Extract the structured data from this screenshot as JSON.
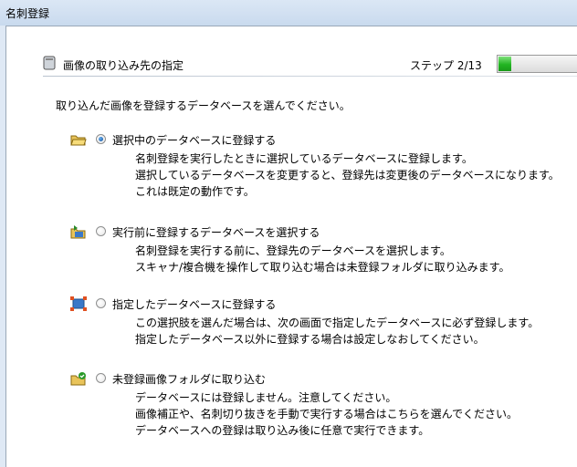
{
  "window": {
    "title": "名刺登録"
  },
  "header": {
    "title": "画像の取り込み先の指定",
    "step_label": "ステップ 2/13",
    "progress_fraction": 0.154
  },
  "intro": "取り込んだ画像を登録するデータベースを選んでください。",
  "options": [
    {
      "label": "選択中のデータベースに登録する",
      "selected": true,
      "desc": [
        "名刺登録を実行したときに選択しているデータベースに登録します。",
        "選択しているデータベースを変更すると、登録先は変更後のデータベースになります。",
        "これは既定の動作です。"
      ]
    },
    {
      "label": "実行前に登録するデータベースを選択する",
      "selected": false,
      "desc": [
        "名刺登録を実行する前に、登録先のデータベースを選択します。",
        "スキャナ/複合機を操作して取り込む場合は未登録フォルダに取り込みます。"
      ]
    },
    {
      "label": "指定したデータベースに登録する",
      "selected": false,
      "desc": [
        "この選択肢を選んだ場合は、次の画面で指定したデータベースに必ず登録します。",
        "指定したデータベース以外に登録する場合は設定しなおしてください。"
      ]
    },
    {
      "label": "未登録画像フォルダに取り込む",
      "selected": false,
      "desc": [
        "データベースには登録しません。注意してください。",
        "画像補正や、名刺切り抜きを手動で実行する場合はこちらを選んでください。",
        "データベースへの登録は取り込み後に任意で実行できます。"
      ]
    }
  ]
}
